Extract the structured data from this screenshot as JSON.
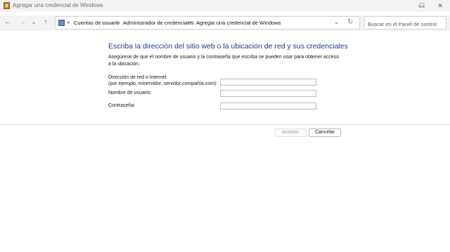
{
  "window": {
    "title": "Agregar una credencial de Windows",
    "minimize_glyph": "—",
    "maximize_glyph": "☐",
    "close_glyph": "✕"
  },
  "nav": {
    "back_glyph": "←",
    "forward_glyph": "→",
    "recent_glyph": "⌄",
    "up_glyph": "↑"
  },
  "address": {
    "overflow_glyph": "«",
    "breadcrumbs": [
      "Cuentas de usuario",
      "Administrador de credenciales",
      "Agregar una credencial de Windows"
    ],
    "separator_glyph": "›",
    "dropdown_glyph": "⌄",
    "refresh_glyph": "↻"
  },
  "search": {
    "placeholder": "Buscar en el Panel de control"
  },
  "main": {
    "heading": "Escriba la dirección del sitio web o la ubicación de red y sus credenciales",
    "intro": "Asegúrese de que el nombre de usuario y la contraseña que escriba se pueden usar para obtener acceso a la ubicación.",
    "fields": {
      "address_label_1": "Dirección de red o Internet",
      "address_label_2": "(por ejemplo, miservidor, servidor.compañía.com):",
      "address_value": "",
      "username_label": "Nombre de usuario:",
      "username_value": "",
      "password_label": "Contraseña:",
      "password_value": ""
    }
  },
  "buttons": {
    "accept": "Aceptar",
    "cancel": "Cancelar"
  },
  "icons": {
    "app": "credential-manager-icon",
    "address": "control-panel-icon"
  }
}
